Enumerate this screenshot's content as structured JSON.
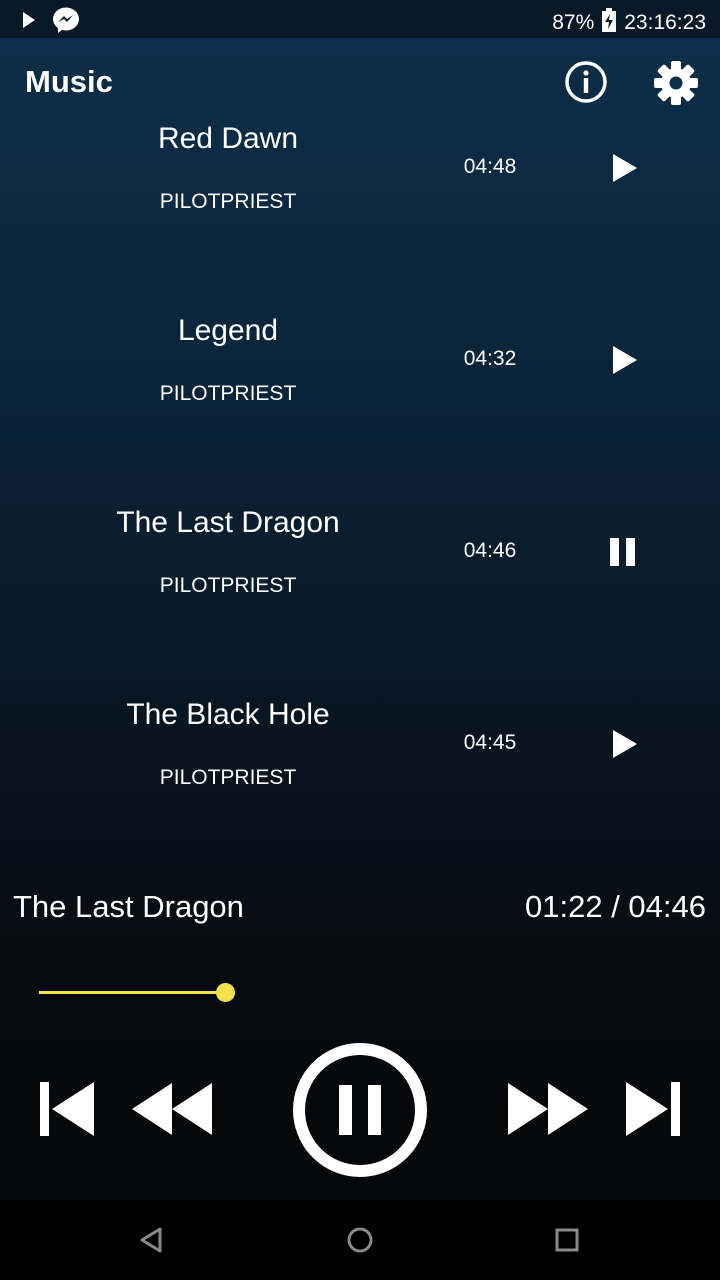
{
  "status_bar": {
    "battery": "87%",
    "time": "23:16:23",
    "icons": [
      "play-notification-icon",
      "messenger-icon",
      "battery-charging-icon"
    ]
  },
  "app_bar": {
    "title": "Music",
    "actions": [
      "info-icon",
      "gear-icon"
    ]
  },
  "tracks": [
    {
      "title": "Red Dawn",
      "artist": "PILOTPRIEST",
      "duration": "04:48",
      "state": "play"
    },
    {
      "title": "Legend",
      "artist": "PILOTPRIEST",
      "duration": "04:32",
      "state": "play"
    },
    {
      "title": "The Last Dragon",
      "artist": "PILOTPRIEST",
      "duration": "04:46",
      "state": "pause"
    },
    {
      "title": "The Black Hole",
      "artist": "PILOTPRIEST",
      "duration": "04:45",
      "state": "play"
    }
  ],
  "now_playing": {
    "title": "The Last Dragon",
    "time": "01:22 / 04:46",
    "progress": 0.286
  },
  "controls": [
    "skip-previous-icon",
    "rewind-icon",
    "pause-icon",
    "fast-forward-icon",
    "skip-next-icon"
  ],
  "nav_bar": [
    "back-icon",
    "home-icon",
    "recents-icon"
  ],
  "colors": {
    "accent": "#f5e24a",
    "background_top": "#0d2f4a",
    "background_bottom": "#050505",
    "text": "#ffffff"
  }
}
